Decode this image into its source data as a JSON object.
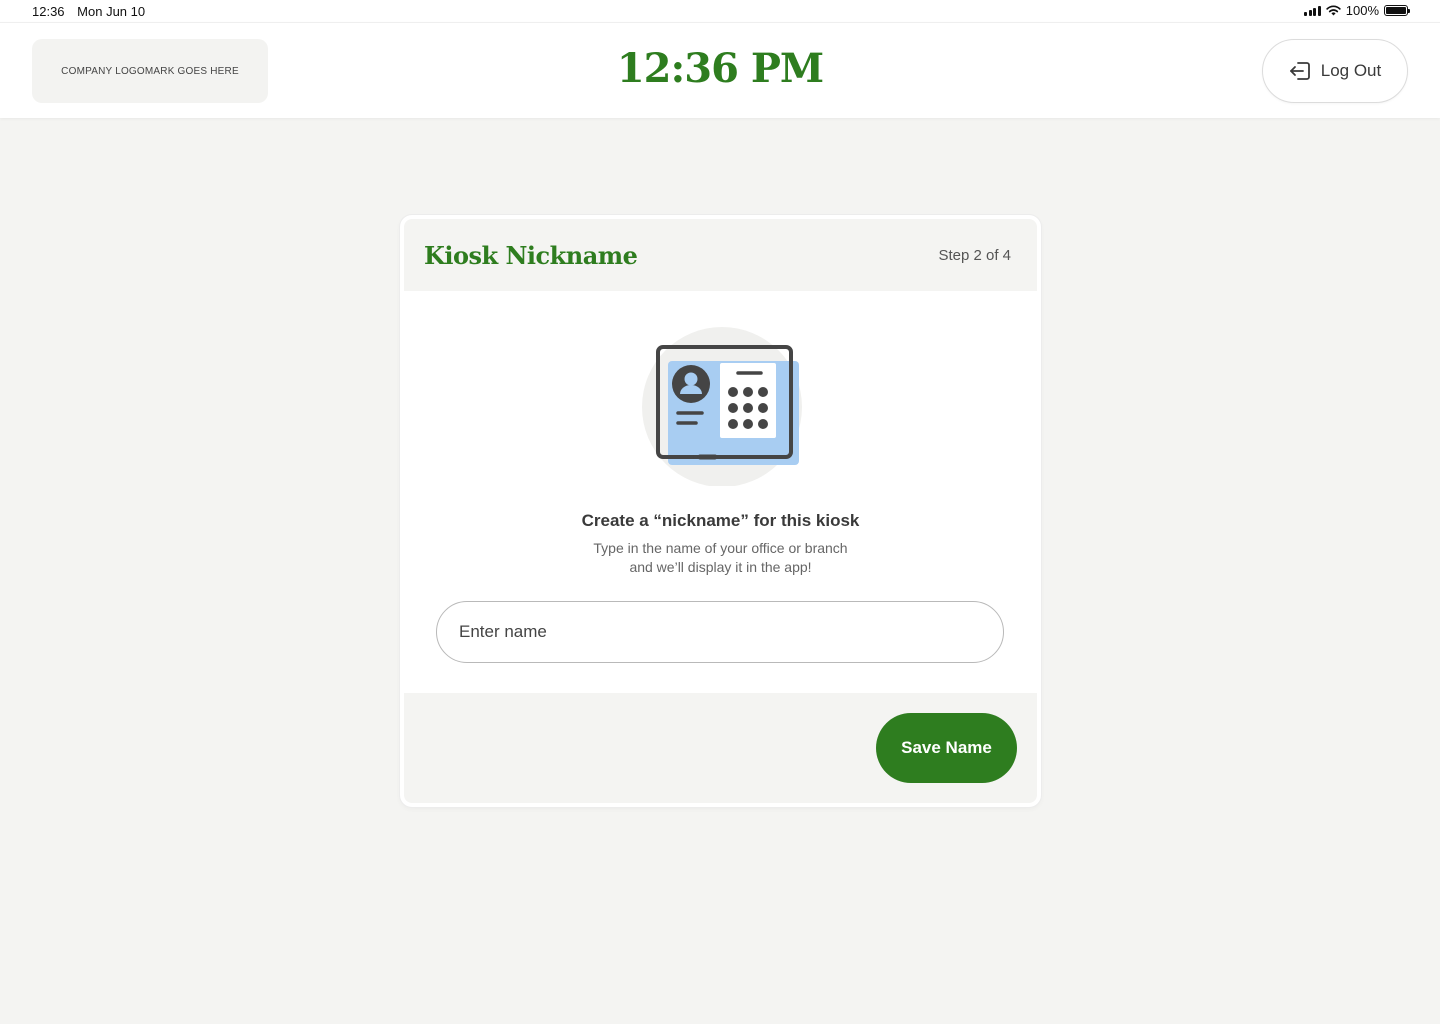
{
  "status_bar": {
    "time": "12:36",
    "date": "Mon Jun 10",
    "battery": "100%"
  },
  "header": {
    "logo_text": "COMPANY LOGOMARK GOES HERE",
    "clock": "12:36 PM",
    "logout_label": "Log Out"
  },
  "card": {
    "title": "Kiosk Nickname",
    "step": "Step 2 of 4",
    "heading": "Create a “nickname” for this kiosk",
    "description_line1": "Type in the name of your office or branch",
    "description_line2": "and we’ll display it in the app!",
    "input_placeholder": "Enter name",
    "input_value": "",
    "save_label": "Save Name"
  },
  "colors": {
    "brand_green": "#2e7d1f",
    "illustration_blue": "#a8cdf2",
    "page_background": "#f4f4f2"
  }
}
